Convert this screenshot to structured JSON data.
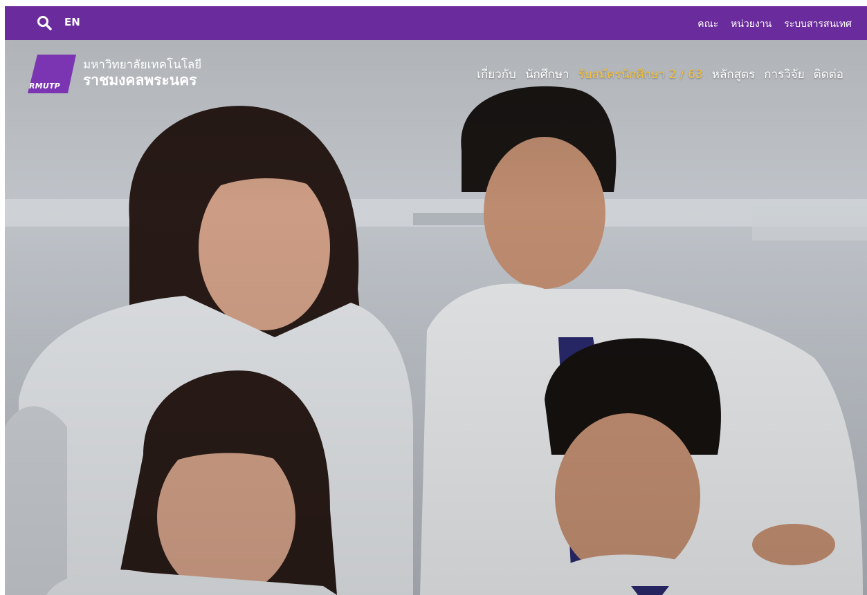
{
  "topbar": {
    "lang_label": "EN",
    "links": [
      "คณะ",
      "หน่วยงาน",
      "ระบบสารสนเทศ"
    ]
  },
  "logo": {
    "mark_text": "RMUTP",
    "name_line1": "มหาวิทยาลัยเทคโนโลยี",
    "name_line2": "ราชมงคลพระนคร"
  },
  "nav": {
    "items": [
      "เกี่ยวกับ",
      "นักศึกษา",
      "รับสมัครนักศึกษา 2 / 63",
      "หลักสูตร",
      "การวิจัย",
      "ติดต่อ"
    ]
  },
  "colors": {
    "topbar_bg": "#6a2c9c",
    "highlight_nav": "#f5c13b",
    "logo_mark": "#7b35b3"
  },
  "icons": {
    "search": "search-icon"
  }
}
